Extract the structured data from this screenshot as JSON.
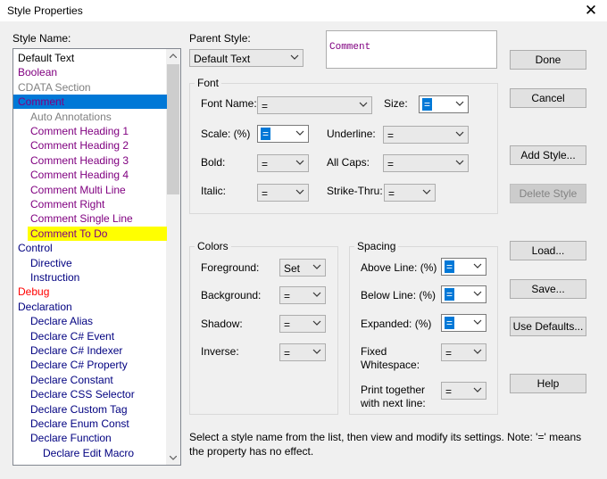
{
  "window": {
    "title": "Style Properties"
  },
  "labels": {
    "style_name": "Style Name:",
    "parent_style": "Parent Style:",
    "font_group": "Font",
    "font_name": "Font Name:",
    "size": "Size:",
    "scale": "Scale: (%)",
    "underline": "Underline:",
    "bold": "Bold:",
    "all_caps": "All Caps:",
    "italic": "Italic:",
    "strike_thru": "Strike-Thru:",
    "colors_group": "Colors",
    "foreground": "Foreground:",
    "background": "Background:",
    "shadow": "Shadow:",
    "inverse": "Inverse:",
    "spacing_group": "Spacing",
    "above_line": "Above Line: (%)",
    "below_line": "Below Line: (%)",
    "expanded": "Expanded: (%)",
    "fixed_ws_1": "Fixed",
    "fixed_ws_2": "Whitespace:",
    "print_together_1": "Print together",
    "print_together_2": "with next line:"
  },
  "values": {
    "parent_style": "Default Text",
    "font_name": "=",
    "size": "=",
    "scale": "=",
    "underline": "=",
    "bold": "=",
    "all_caps": "=",
    "italic": "=",
    "strike_thru": "=",
    "foreground": "Set",
    "background": "=",
    "shadow": "=",
    "inverse": "=",
    "above_line": "=",
    "below_line": "=",
    "expanded": "=",
    "fixed_whitespace": "=",
    "print_together": "="
  },
  "preview": {
    "text": "Comment",
    "color": "#800080"
  },
  "buttons": {
    "done": "Done",
    "cancel": "Cancel",
    "add_style": "Add Style...",
    "delete_style": "Delete Style",
    "load": "Load...",
    "save": "Save...",
    "use_defaults": "Use Defaults...",
    "help": "Help"
  },
  "note": "Select a style name from the list, then view and modify its settings. Note: '=' means the property has no effect.",
  "style_list": [
    {
      "label": "Default Text",
      "indent": 0,
      "color": "#000000"
    },
    {
      "label": "Boolean",
      "indent": 0,
      "color": "#800080"
    },
    {
      "label": "CDATA Section",
      "indent": 0,
      "color": "#808080"
    },
    {
      "label": "Comment",
      "indent": 0,
      "color": "#800080",
      "selected": true
    },
    {
      "label": "Auto Annotations",
      "indent": 1,
      "color": "#808080"
    },
    {
      "label": "Comment Heading 1",
      "indent": 1,
      "color": "#800080"
    },
    {
      "label": "Comment Heading 2",
      "indent": 1,
      "color": "#800080"
    },
    {
      "label": "Comment Heading 3",
      "indent": 1,
      "color": "#800080"
    },
    {
      "label": "Comment Heading 4",
      "indent": 1,
      "color": "#800080"
    },
    {
      "label": "Comment Multi Line",
      "indent": 1,
      "color": "#800080"
    },
    {
      "label": "Comment Right",
      "indent": 1,
      "color": "#800080"
    },
    {
      "label": "Comment Single Line",
      "indent": 1,
      "color": "#800080"
    },
    {
      "label": "Comment To Do",
      "indent": 1,
      "color": "#800080",
      "highlight": "#ffff00"
    },
    {
      "label": "Control",
      "indent": 0,
      "color": "#000080"
    },
    {
      "label": "Directive",
      "indent": 1,
      "color": "#000080"
    },
    {
      "label": "Instruction",
      "indent": 1,
      "color": "#000080"
    },
    {
      "label": "Debug",
      "indent": 0,
      "color": "#ff0000"
    },
    {
      "label": "Declaration",
      "indent": 0,
      "color": "#000080"
    },
    {
      "label": "Declare Alias",
      "indent": 1,
      "color": "#000080"
    },
    {
      "label": "Declare C# Event",
      "indent": 1,
      "color": "#000080"
    },
    {
      "label": "Declare C# Indexer",
      "indent": 1,
      "color": "#000080"
    },
    {
      "label": "Declare C# Property",
      "indent": 1,
      "color": "#000080"
    },
    {
      "label": "Declare Constant",
      "indent": 1,
      "color": "#000080"
    },
    {
      "label": "Declare CSS Selector",
      "indent": 1,
      "color": "#000080"
    },
    {
      "label": "Declare Custom Tag",
      "indent": 1,
      "color": "#000080"
    },
    {
      "label": "Declare Enum Const",
      "indent": 1,
      "color": "#000080"
    },
    {
      "label": "Declare Function",
      "indent": 1,
      "color": "#000080"
    },
    {
      "label": "Declare Edit Macro",
      "indent": 2,
      "color": "#000080"
    }
  ],
  "selection_color": "#0078d7"
}
